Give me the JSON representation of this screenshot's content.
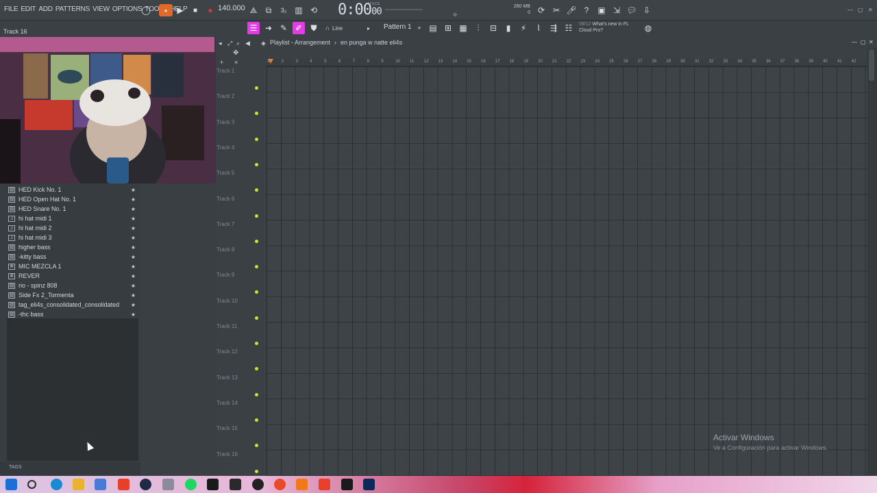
{
  "menu": [
    "FILE",
    "EDIT",
    "ADD",
    "PATTERNS",
    "VIEW",
    "OPTIONS",
    "TOOLS",
    "HELP"
  ],
  "transport": {
    "tempo": "140.000",
    "time_main": "0:00",
    "time_sub": "00",
    "time_unit_label": "M:S:CS"
  },
  "memory": {
    "line1": "260 MB",
    "line2": "0"
  },
  "hint": "Track 16",
  "news": {
    "date": "09/12",
    "text": "What's new in FL Cloud Pro?"
  },
  "toolbar2": {
    "snap": "Line",
    "pattern": "Pattern 1"
  },
  "playlist": {
    "title": "Playlist - Arrangement",
    "breadcrumb_sep": "›",
    "project": "en punga w natte eli4s"
  },
  "browser": {
    "items": [
      {
        "label": "HED Kick No. 1",
        "icon": "pattern-icon"
      },
      {
        "label": "HED Open Hat No. 1",
        "icon": "pattern-icon"
      },
      {
        "label": "HED Snare No. 1",
        "icon": "pattern-icon"
      },
      {
        "label": "hi hat midi 1",
        "icon": "piano-icon"
      },
      {
        "label": "hi hat midi 2",
        "icon": "piano-icon"
      },
      {
        "label": "hi hat midi 3",
        "icon": "piano-icon"
      },
      {
        "label": "higher bass",
        "icon": "pattern-icon"
      },
      {
        "label": "-kitty bass",
        "icon": "pattern-icon"
      },
      {
        "label": "MIC MEZCLA 1",
        "icon": "gear-icon"
      },
      {
        "label": "REVER",
        "icon": "gear-icon"
      },
      {
        "label": "rio - spinz 808",
        "icon": "pattern-icon"
      },
      {
        "label": "Side Fx 2_Tormenta",
        "icon": "pattern-icon"
      },
      {
        "label": "tag_eli4s_consolidated_consolidated",
        "icon": "pattern-icon"
      },
      {
        "label": "-thc bass",
        "icon": "pattern-icon"
      }
    ],
    "star": "★",
    "tags_label": "TAGS"
  },
  "tracks": [
    "Track 1",
    "Track 2",
    "Track 3",
    "Track 4",
    "Track 5",
    "Track 6",
    "Track 7",
    "Track 8",
    "Track 9",
    "Track 10",
    "Track 11",
    "Track 12",
    "Track 13",
    "Track 14",
    "Track 15",
    "Track 16"
  ],
  "ruler": [
    "1",
    "2",
    "3",
    "4",
    "5",
    "6",
    "7",
    "8",
    "9",
    "10",
    "11",
    "12",
    "13",
    "14",
    "15",
    "16",
    "17",
    "18",
    "19",
    "20",
    "21",
    "22",
    "23",
    "24",
    "25",
    "26",
    "27",
    "28",
    "29",
    "30",
    "31",
    "32",
    "33",
    "34",
    "35",
    "36",
    "37",
    "38",
    "39",
    "40",
    "41",
    "42"
  ],
  "watermark": {
    "line1": "Activar Windows",
    "line2": "Ve a Configuración para activar Windows."
  },
  "colors": {
    "accent": "#e23ce4",
    "record": "#e0343a",
    "mute_dot": "#c8e43a"
  }
}
